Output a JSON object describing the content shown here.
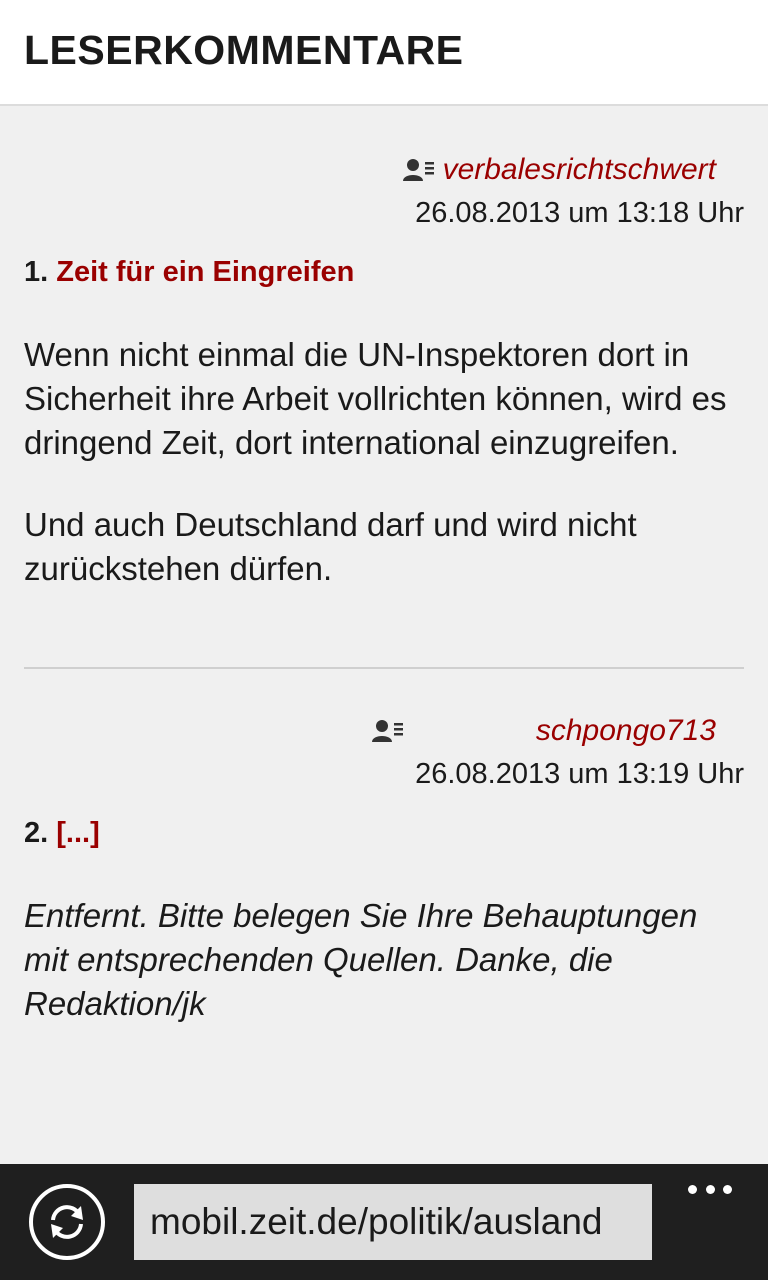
{
  "header": {
    "title": "LESERKOMMENTARE"
  },
  "comments": [
    {
      "author": "verbalesrichtschwert",
      "date": "26.08.2013 um 13:18 Uhr",
      "number": "1.",
      "title": "Zeit für ein Eingreifen",
      "paragraphs": [
        "Wenn nicht einmal die UN-Inspektoren dort in Sicherheit ihre Arbeit vollrichten können, wird es dringend Zeit, dort international einzugreifen.",
        "Und auch Deutschland darf und wird nicht zurückstehen dürfen."
      ]
    },
    {
      "author": "schpongo713",
      "date": "26.08.2013 um 13:19 Uhr",
      "number": "2.",
      "title": "[...]",
      "paragraphs": [
        "Entfernt. Bitte belegen Sie Ihre Behauptungen mit entsprechenden Quellen. Danke, die Redaktion/jk"
      ]
    }
  ],
  "appbar": {
    "url": "mobil.zeit.de/politik/ausland",
    "refresh_icon": "refresh-icon",
    "more_icon": "ellipsis-icon"
  },
  "colors": {
    "accent": "#9a0000",
    "background": "#f0f0f0",
    "header_bg": "#ffffff",
    "appbar_bg": "#1f1f1f",
    "address_bg": "#dedede"
  }
}
